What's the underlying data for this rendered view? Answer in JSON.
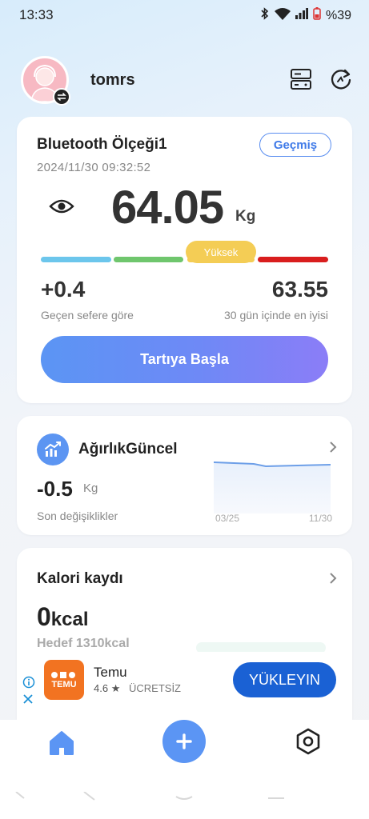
{
  "status": {
    "time": "13:33",
    "battery": "%39"
  },
  "profile": {
    "username": "tomrs"
  },
  "scale_card": {
    "name": "Bluetooth Ölçeği1",
    "date": "2024/11/30 09:32:52",
    "history_button": "Geçmiş",
    "weight": "64.05",
    "unit": "Kg",
    "level_badge": "Yüksek",
    "delta_value": "+0.4",
    "delta_label": "Geçen sefere göre",
    "best_value": "63.55",
    "best_label": "30 gün içinde en iyisi",
    "start_button": "Tartıya Başla",
    "colors": {
      "seg_blue": "#6cc6ec",
      "seg_green": "#6fc66d",
      "seg_yellow": "#f4cd55",
      "seg_red": "#d91e1e"
    }
  },
  "trend_card": {
    "title": "AğırlıkGüncel",
    "value": "-0.5",
    "unit": "Kg",
    "label": "Son değişiklikler",
    "x_start": "03/25",
    "x_end": "11/30"
  },
  "calorie_card": {
    "title": "Kalori kaydı",
    "value_number": "0",
    "value_unit": "kcal",
    "goal": "Hedef 1310kcal"
  },
  "ad": {
    "app_name": "Temu",
    "rating": "4.6",
    "price": "ÜCRETSİZ",
    "install_button": "YÜKLEYIN",
    "logo_text": "TEMU"
  },
  "icons": {
    "top_right": [
      "layout-icon",
      "refresh-icon"
    ],
    "nav": [
      "home-icon",
      "add-icon",
      "settings-icon"
    ]
  }
}
